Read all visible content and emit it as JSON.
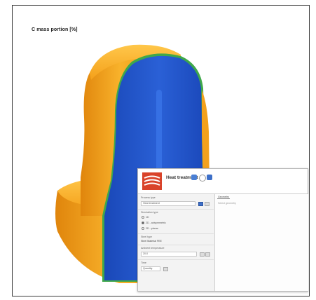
{
  "figure": {
    "title": "C mass portion [%]"
  },
  "dialog": {
    "title": "Heat treatment",
    "left": {
      "process_label": "Process type",
      "process_value": "Heat treatment",
      "simulation_label": "Simulation type",
      "options": [
        "1D",
        "2D - axisymmetric",
        "2D - planar"
      ],
      "selected_option": 1,
      "material_label": "Steel type",
      "material_value": "Steel Material FEE",
      "temperature_label": "Ambient temperature",
      "temperature_value": "20.0",
      "time_label": "Time",
      "time_value": "Quantity"
    },
    "right": {
      "tab_label": "Geometry",
      "placeholder": "Select geometry"
    }
  },
  "colors": {
    "surface_orange": "#f6a21a",
    "surface_blue": "#1c4fc4",
    "edge_green": "#3fa84a",
    "logo_red": "#d9432a"
  }
}
